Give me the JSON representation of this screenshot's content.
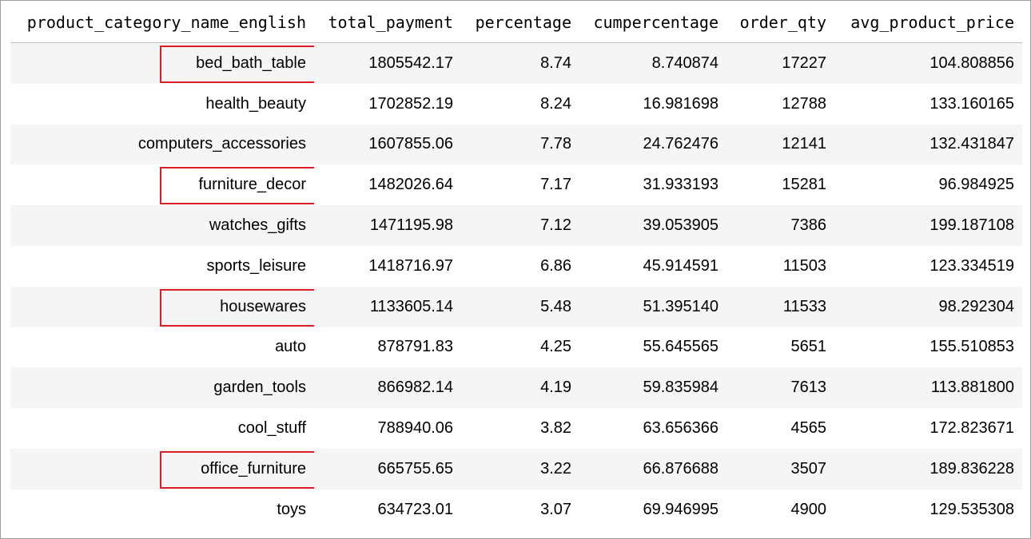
{
  "table": {
    "columns": [
      "product_category_name_english",
      "total_payment",
      "percentage",
      "cumpercentage",
      "order_qty",
      "avg_product_price"
    ],
    "rows": [
      {
        "category": "bed_bath_table",
        "total_payment": "1805542.17",
        "percentage": "8.74",
        "cumpercentage": "8.740874",
        "order_qty": "17227",
        "avg_product_price": "104.808856",
        "highlighted": true
      },
      {
        "category": "health_beauty",
        "total_payment": "1702852.19",
        "percentage": "8.24",
        "cumpercentage": "16.981698",
        "order_qty": "12788",
        "avg_product_price": "133.160165",
        "highlighted": false
      },
      {
        "category": "computers_accessories",
        "total_payment": "1607855.06",
        "percentage": "7.78",
        "cumpercentage": "24.762476",
        "order_qty": "12141",
        "avg_product_price": "132.431847",
        "highlighted": false
      },
      {
        "category": "furniture_decor",
        "total_payment": "1482026.64",
        "percentage": "7.17",
        "cumpercentage": "31.933193",
        "order_qty": "15281",
        "avg_product_price": "96.984925",
        "highlighted": true
      },
      {
        "category": "watches_gifts",
        "total_payment": "1471195.98",
        "percentage": "7.12",
        "cumpercentage": "39.053905",
        "order_qty": "7386",
        "avg_product_price": "199.187108",
        "highlighted": false
      },
      {
        "category": "sports_leisure",
        "total_payment": "1418716.97",
        "percentage": "6.86",
        "cumpercentage": "45.914591",
        "order_qty": "11503",
        "avg_product_price": "123.334519",
        "highlighted": false
      },
      {
        "category": "housewares",
        "total_payment": "1133605.14",
        "percentage": "5.48",
        "cumpercentage": "51.395140",
        "order_qty": "11533",
        "avg_product_price": "98.292304",
        "highlighted": true
      },
      {
        "category": "auto",
        "total_payment": "878791.83",
        "percentage": "4.25",
        "cumpercentage": "55.645565",
        "order_qty": "5651",
        "avg_product_price": "155.510853",
        "highlighted": false
      },
      {
        "category": "garden_tools",
        "total_payment": "866982.14",
        "percentage": "4.19",
        "cumpercentage": "59.835984",
        "order_qty": "7613",
        "avg_product_price": "113.881800",
        "highlighted": false
      },
      {
        "category": "cool_stuff",
        "total_payment": "788940.06",
        "percentage": "3.82",
        "cumpercentage": "63.656366",
        "order_qty": "4565",
        "avg_product_price": "172.823671",
        "highlighted": false
      },
      {
        "category": "office_furniture",
        "total_payment": "665755.65",
        "percentage": "3.22",
        "cumpercentage": "66.876688",
        "order_qty": "3507",
        "avg_product_price": "189.836228",
        "highlighted": true
      },
      {
        "category": "toys",
        "total_payment": "634723.01",
        "percentage": "3.07",
        "cumpercentage": "69.946995",
        "order_qty": "4900",
        "avg_product_price": "129.535308",
        "highlighted": false
      }
    ]
  },
  "colors": {
    "highlight_border": "#d81f26",
    "row_stripe": "#f5f5f5",
    "frame_border": "#9e9e9e"
  }
}
